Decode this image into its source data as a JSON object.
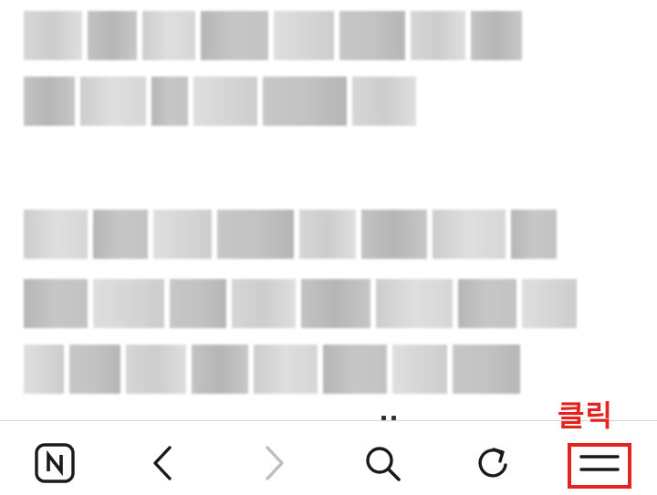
{
  "toolbar": {
    "buttons": [
      {
        "icon": "naver-n-icon"
      },
      {
        "icon": "back-arrow-icon"
      },
      {
        "icon": "forward-arrow-icon",
        "disabled": true
      },
      {
        "icon": "search-icon"
      },
      {
        "icon": "refresh-icon"
      },
      {
        "icon": "menu-icon"
      }
    ]
  },
  "annotation": {
    "label": "클릭",
    "color": "#e4231f"
  }
}
